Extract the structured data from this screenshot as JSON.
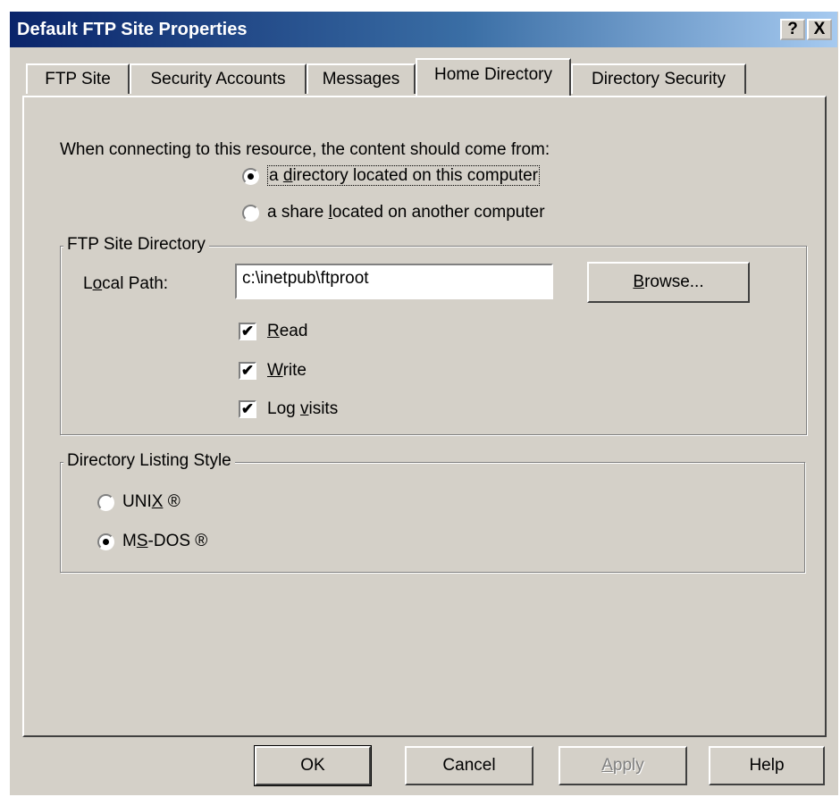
{
  "window": {
    "title": "Default FTP Site Properties",
    "help_glyph": "?",
    "close_glyph": "X"
  },
  "tabs": [
    {
      "label": "FTP Site",
      "active": false
    },
    {
      "label": "Security Accounts",
      "active": false
    },
    {
      "label": "Messages",
      "active": false
    },
    {
      "label": "Home Directory",
      "active": true
    },
    {
      "label": "Directory Security",
      "active": false
    }
  ],
  "content_source": {
    "prompt": "When connecting to this resource, the content should come from:",
    "options": [
      {
        "pre": "a ",
        "key": "d",
        "post": "irectory located on this computer",
        "selected": true
      },
      {
        "pre": "a share ",
        "key": "l",
        "post": "ocated on another computer",
        "selected": false
      }
    ]
  },
  "ftp_directory": {
    "legend": "FTP Site Directory",
    "path_label_pre": "L",
    "path_label_key": "o",
    "path_label_post": "cal Path:",
    "path_value": "c:\\inetpub\\ftproot",
    "browse_pre": "",
    "browse_key": "B",
    "browse_post": "rowse...",
    "permissions": [
      {
        "pre": "",
        "key": "R",
        "post": "ead",
        "checked": true
      },
      {
        "pre": "",
        "key": "W",
        "post": "rite",
        "checked": true
      },
      {
        "pre": "Log ",
        "key": "v",
        "post": "isits",
        "checked": true
      }
    ],
    "check_glyph": "✔"
  },
  "listing_style": {
    "legend": "Directory Listing Style",
    "options": [
      {
        "pre": "UNI",
        "key": "X",
        "post": " ®",
        "selected": false
      },
      {
        "pre": "M",
        "key": "S",
        "post": "-DOS ®",
        "selected": true
      }
    ]
  },
  "buttons": {
    "ok": "OK",
    "cancel": "Cancel",
    "apply_key": "A",
    "apply_post": "pply",
    "help": "Help"
  }
}
